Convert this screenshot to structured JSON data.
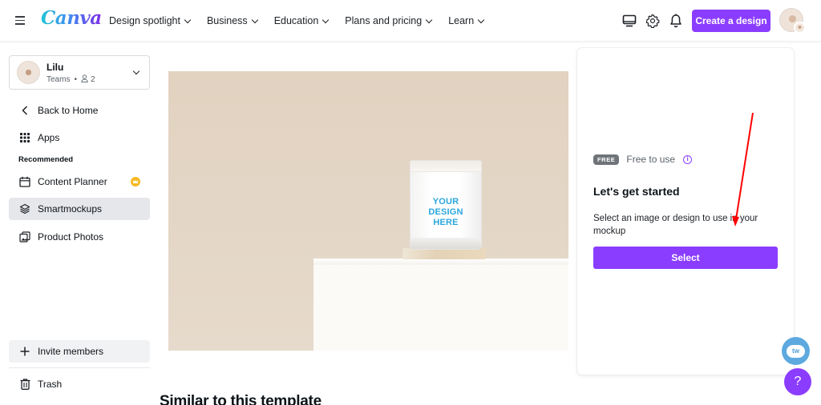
{
  "header": {
    "logo": "Canva",
    "nav": [
      {
        "label": "Design spotlight"
      },
      {
        "label": "Business"
      },
      {
        "label": "Education"
      },
      {
        "label": "Plans and pricing"
      },
      {
        "label": "Learn"
      }
    ],
    "icons": [
      "desktop-icon",
      "gear-icon",
      "bell-icon"
    ],
    "create_button": "Create a design"
  },
  "sidebar": {
    "team": {
      "name": "Lilu",
      "type": "Teams",
      "members": "2"
    },
    "back": "Back to Home",
    "apps": "Apps",
    "recommended_heading": "Recommended",
    "items": [
      {
        "label": "Content Planner",
        "icon": "calendar-icon",
        "badge": "crown-icon"
      },
      {
        "label": "Smartmockups",
        "icon": "layers-icon",
        "active": true
      },
      {
        "label": "Product Photos",
        "icon": "photos-icon"
      }
    ],
    "invite": "Invite members",
    "trash": "Trash"
  },
  "main": {
    "mockup_text": [
      "YOUR",
      "DESIGN",
      "HERE"
    ],
    "similar_heading": "Similar to this template"
  },
  "panel": {
    "badge": "FREE",
    "free_text": "Free to use",
    "title": "Let's get started",
    "description": "Select an image or design to use in your mockup",
    "select_button": "Select"
  },
  "floating": {
    "chat_label": "tw",
    "help_label": "?"
  },
  "colors": {
    "brand_purple": "#8b3dff",
    "annotation_red": "#ff0000",
    "crown_gold": "#f5b923"
  }
}
